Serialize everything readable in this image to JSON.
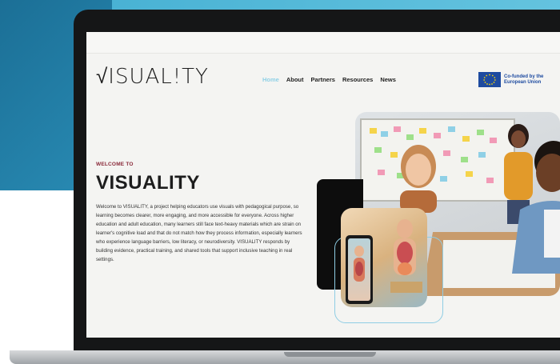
{
  "logo": {
    "text": "√ISUAL!TY"
  },
  "nav": {
    "items": [
      "Home",
      "About",
      "Partners",
      "Resources",
      "News"
    ]
  },
  "eu": {
    "text": "Co-funded by the European Union"
  },
  "hero": {
    "eyebrow": "WELCOME TO",
    "title": "VISUALITY",
    "body": "Welcome to VISUALITY, a project helping educators use visuals with pedagogical purpose, so learning becomes clearer, more engaging, and more accessible for everyone. Across higher education and adult education, many learners still face text-heavy materials which are strain on learner's cognitive load and that do not match how they process information, especially learners who experience language barriers, low literacy, or neurodiversity. VISUALITY responds by building evidence, practical training, and shared tools that support inclusive teaching in real settings."
  },
  "colors": {
    "accent": "#8fd0e6",
    "brand_text": "#1d1d1d",
    "eyebrow": "#8a2a3a",
    "eu_blue": "#1e4ba0"
  }
}
